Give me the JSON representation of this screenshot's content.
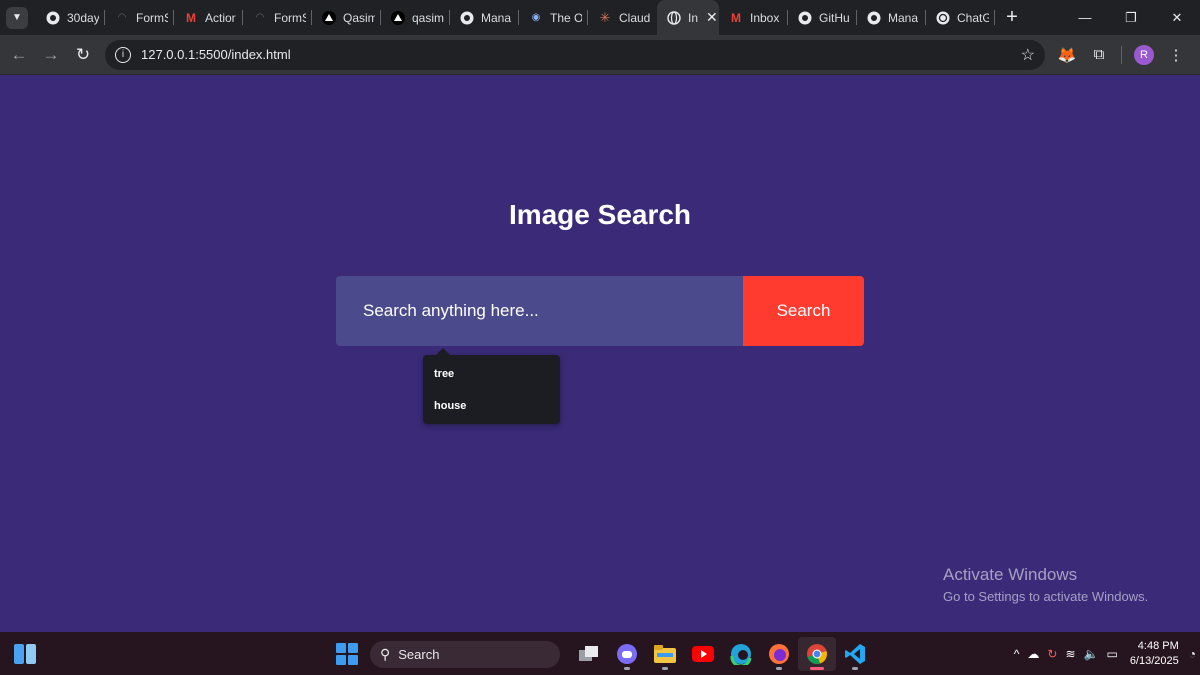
{
  "browser": {
    "tabs": [
      {
        "title": "30day",
        "icon": "github-icon"
      },
      {
        "title": "FormS",
        "icon": "globe-icon"
      },
      {
        "title": "Actior",
        "icon": "gmail-icon"
      },
      {
        "title": "FormS",
        "icon": "globe-icon"
      },
      {
        "title": "Qasim",
        "icon": "triangle-icon"
      },
      {
        "title": "qasim",
        "icon": "triangle-icon"
      },
      {
        "title": "Mana",
        "icon": "github-icon"
      },
      {
        "title": "The O",
        "icon": "planet-icon"
      },
      {
        "title": "Claud",
        "icon": "claude-icon"
      },
      {
        "title": "In",
        "icon": "globe-icon",
        "active": true
      },
      {
        "title": "Inbox",
        "icon": "gmail-icon"
      },
      {
        "title": "GitHu",
        "icon": "github-icon"
      },
      {
        "title": "Mana",
        "icon": "github-icon"
      },
      {
        "title": "ChatG",
        "icon": "chatgpt-icon"
      }
    ],
    "url": "127.0.0.1:5500/index.html",
    "profile_initial": "R"
  },
  "page": {
    "title": "Image Search",
    "search_placeholder": "Search anything here...",
    "search_button": "Search",
    "suggestions": [
      "tree",
      "house"
    ],
    "background_color": "#3a2a78",
    "input_color": "#4a4a8c",
    "button_color": "#ff3b30"
  },
  "watermark": {
    "line1": "Activate Windows",
    "line2": "Go to Settings to activate Windows."
  },
  "taskbar": {
    "search_label": "Search",
    "time": "4:48 PM",
    "date": "6/13/2025"
  }
}
